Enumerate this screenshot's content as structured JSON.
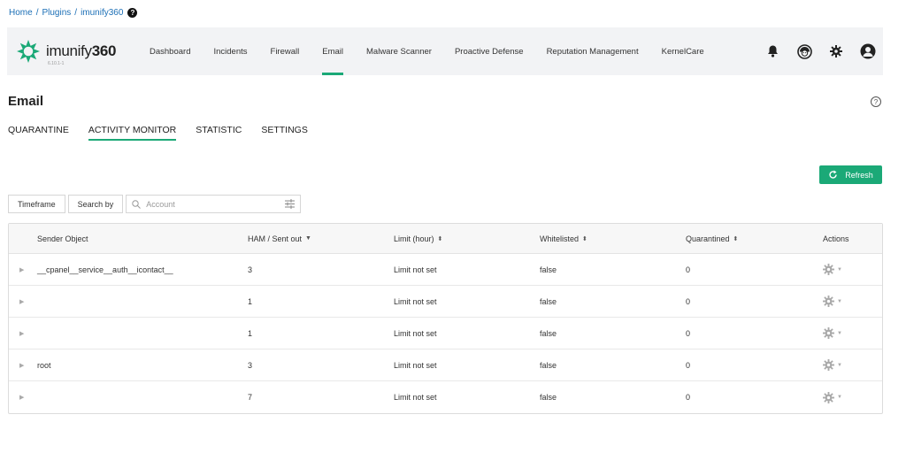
{
  "breadcrumb": {
    "items": [
      "Home",
      "Plugins",
      "imunify360"
    ]
  },
  "app": {
    "logo_name_light": "imunify",
    "logo_name_bold": "360",
    "version": "6.10.1-1",
    "brand_color": "#1ba977"
  },
  "nav": {
    "items": [
      "Dashboard",
      "Incidents",
      "Firewall",
      "Email",
      "Malware Scanner",
      "Proactive Defense",
      "Reputation Management",
      "KernelCare"
    ],
    "active": "Email",
    "icons": [
      "bell-icon",
      "support-icon",
      "gear-icon",
      "user-icon"
    ]
  },
  "page": {
    "title": "Email"
  },
  "subtabs": {
    "items": [
      "QUARANTINE",
      "ACTIVITY MONITOR",
      "STATISTIC",
      "SETTINGS"
    ],
    "active": "ACTIVITY MONITOR"
  },
  "toolbar": {
    "refresh_label": "Refresh",
    "timeframe_label": "Timeframe",
    "search_by_label": "Search by",
    "search_placeholder": "Account"
  },
  "table": {
    "headers": {
      "sender": "Sender Object",
      "ham": "HAM / Sent out",
      "limit": "Limit (hour)",
      "whitelisted": "Whitelisted",
      "quarantined": "Quarantined",
      "actions": "Actions"
    },
    "rows": [
      {
        "sender": "__cpanel__service__auth__icontact__",
        "ham": "3",
        "limit": "Limit not set",
        "whitelisted": "false",
        "quarantined": "0"
      },
      {
        "sender": "",
        "ham": "1",
        "limit": "Limit not set",
        "whitelisted": "false",
        "quarantined": "0"
      },
      {
        "sender": "",
        "ham": "1",
        "limit": "Limit not set",
        "whitelisted": "false",
        "quarantined": "0"
      },
      {
        "sender": "root",
        "ham": "3",
        "limit": "Limit not set",
        "whitelisted": "false",
        "quarantined": "0"
      },
      {
        "sender": "",
        "ham": "7",
        "limit": "Limit not set",
        "whitelisted": "false",
        "quarantined": "0"
      }
    ]
  }
}
